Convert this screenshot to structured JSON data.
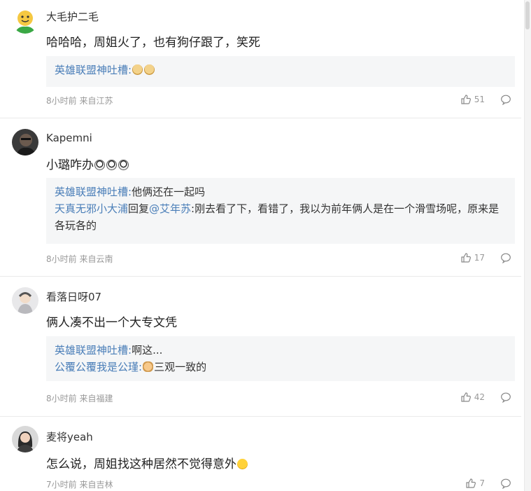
{
  "comments": [
    {
      "username": "大毛护二毛",
      "content": "哈哈哈，周姐火了，也有狗仔跟了，笑死",
      "reply_lines": [
        {
          "author": "英雄联盟神吐槽:",
          "text": ""
        }
      ],
      "meta": "8小时前 来自江苏",
      "likes": "51",
      "avatar_color": "#f5c842"
    },
    {
      "username": "Kapemni",
      "content": "小璐咋办",
      "reply_lines": [
        {
          "author": "英雄联盟神吐槽:",
          "text": "他俩还在一起吗"
        },
        {
          "author": "天真无邪小大浦",
          "mid": "回复",
          "mention": "@艾年苏",
          "text": ":刚去看了下，看错了，我以为前年俩人是在一个滑雪场呢，原来是各玩各的"
        }
      ],
      "meta": "8小时前 来自云南",
      "likes": "17",
      "avatar_color": "#2a2a2a"
    },
    {
      "username": "看落日呀07",
      "content": "俩人凑不出一个大专文凭",
      "reply_lines": [
        {
          "author": "英雄联盟神吐槽:",
          "text": "啊这..."
        },
        {
          "author": "公覆公覆我是公瑾:",
          "text": "三观一致的"
        }
      ],
      "meta": "8小时前 来自福建",
      "likes": "42",
      "avatar_color": "#c8c8c8"
    },
    {
      "username": "麦将yeah",
      "content": "怎么说，周姐找这种居然不觉得意外",
      "meta": "7小时前 来自吉林",
      "likes": "7",
      "avatar_color": "#555555"
    }
  ]
}
